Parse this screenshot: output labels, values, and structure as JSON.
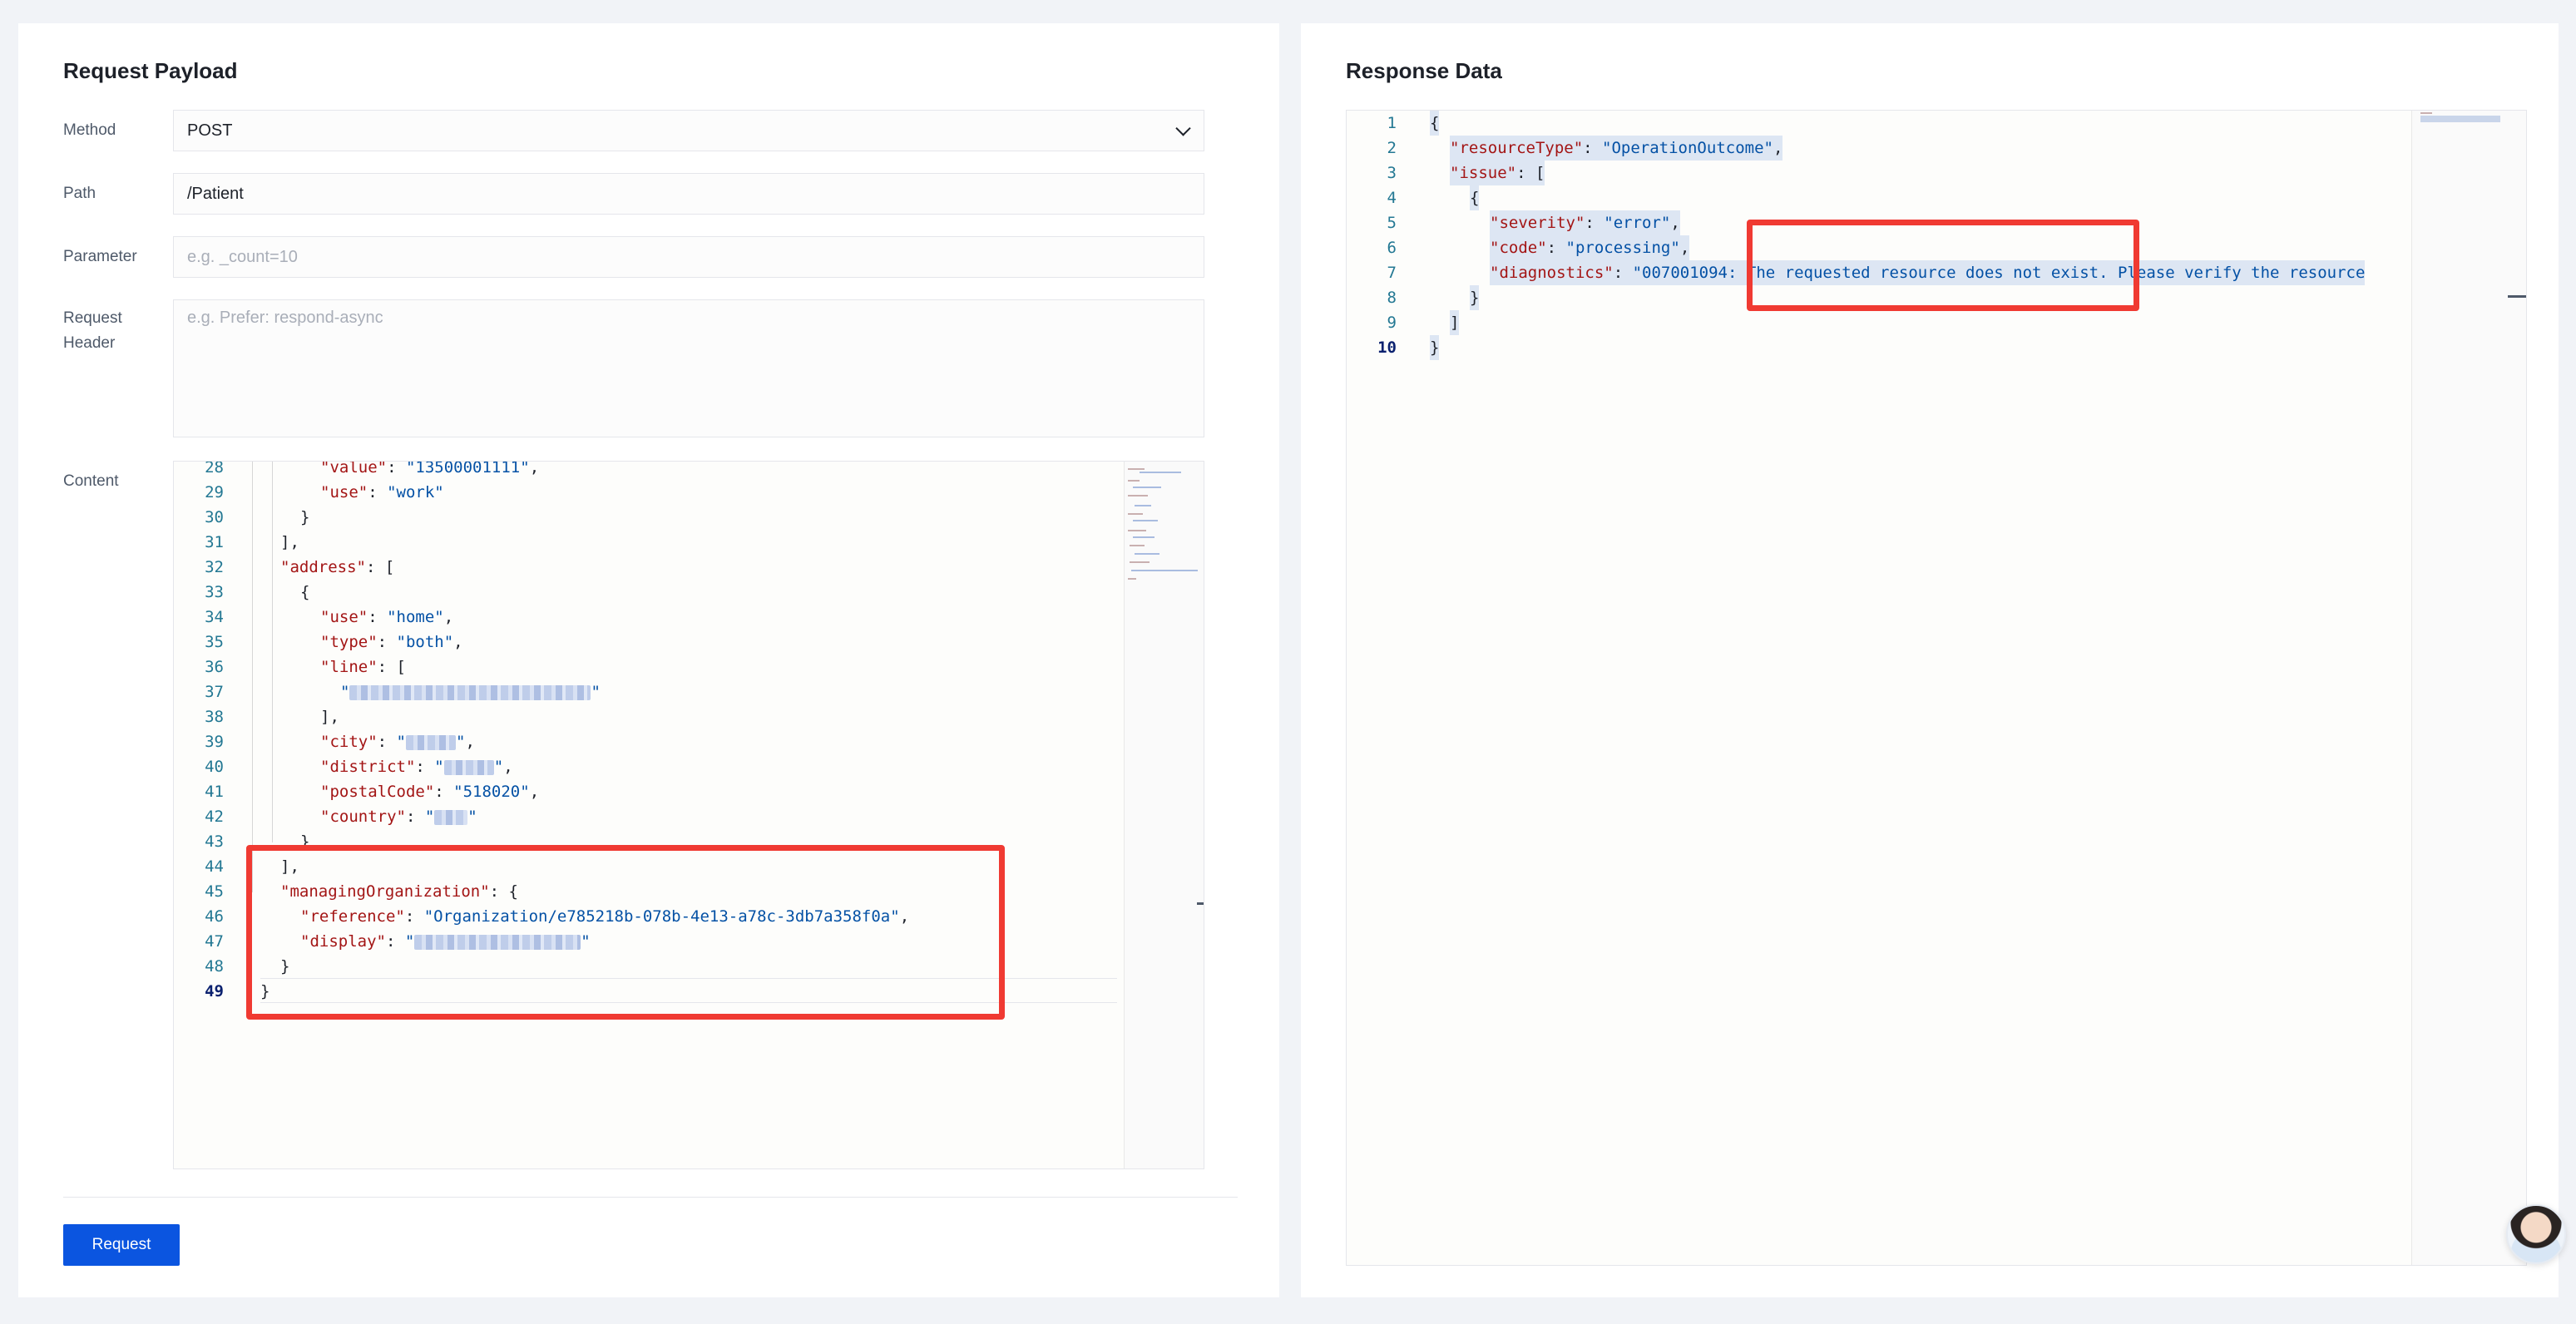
{
  "request": {
    "title": "Request Payload",
    "method_label": "Method",
    "method_value": "POST",
    "path_label": "Path",
    "path_value": "/Patient",
    "parameter_label": "Parameter",
    "parameter_placeholder": "e.g. _count=10",
    "header_label_line1": "Request",
    "header_label_line2": "Header",
    "header_placeholder": "e.g. Prefer: respond-async",
    "content_label": "Content",
    "button_label": "Request",
    "code_lines": [
      {
        "n": "28",
        "indent": 3,
        "key": "\"value\"",
        "val": "\"13500001111\"",
        "tail": ","
      },
      {
        "n": "29",
        "indent": 3,
        "key": "\"use\"",
        "val": "\"work\"",
        "tail": ""
      },
      {
        "n": "30",
        "indent": 2,
        "punct": "}"
      },
      {
        "n": "31",
        "indent": 1,
        "punct": "],"
      },
      {
        "n": "32",
        "indent": 1,
        "key": "\"address\"",
        "punct_after": ": ["
      },
      {
        "n": "33",
        "indent": 2,
        "punct": "{"
      },
      {
        "n": "34",
        "indent": 3,
        "key": "\"use\"",
        "val": "\"home\"",
        "tail": ","
      },
      {
        "n": "35",
        "indent": 3,
        "key": "\"type\"",
        "val": "\"both\"",
        "tail": ","
      },
      {
        "n": "36",
        "indent": 3,
        "key": "\"line\"",
        "punct_after": ": ["
      },
      {
        "n": "37",
        "indent": 4,
        "blur_val": true,
        "blur_w": 290,
        "tail": ""
      },
      {
        "n": "38",
        "indent": 3,
        "punct": "],"
      },
      {
        "n": "39",
        "indent": 3,
        "key": "\"city\"",
        "blur_val": true,
        "blur_w": 60,
        "tail": ","
      },
      {
        "n": "40",
        "indent": 3,
        "key": "\"district\"",
        "blur_val": true,
        "blur_w": 60,
        "tail": ","
      },
      {
        "n": "41",
        "indent": 3,
        "key": "\"postalCode\"",
        "val": "\"518020\"",
        "tail": ","
      },
      {
        "n": "42",
        "indent": 3,
        "key": "\"country\"",
        "blur_val": true,
        "blur_w": 40,
        "tail": ""
      },
      {
        "n": "43",
        "indent": 2,
        "punct": "}"
      },
      {
        "n": "44",
        "indent": 1,
        "punct": "],"
      },
      {
        "n": "45",
        "indent": 1,
        "key": "\"managingOrganization\"",
        "punct_after": ": {"
      },
      {
        "n": "46",
        "indent": 2,
        "key": "\"reference\"",
        "val": "\"Organization/e785218b-078b-4e13-a78c-3db7a358f0a\"",
        "tail": ","
      },
      {
        "n": "47",
        "indent": 2,
        "key": "\"display\"",
        "blur_val": true,
        "blur_w": 200,
        "tail": ""
      },
      {
        "n": "48",
        "indent": 1,
        "punct": "}"
      },
      {
        "n": "49",
        "indent": 0,
        "punct": "}",
        "active": true
      }
    ]
  },
  "response": {
    "title": "Response Data",
    "code_lines": [
      {
        "n": "1",
        "indent": 0,
        "punct": "{"
      },
      {
        "n": "2",
        "indent": 1,
        "key": "\"resourceType\"",
        "val": "\"OperationOutcome\"",
        "tail": ","
      },
      {
        "n": "3",
        "indent": 1,
        "key": "\"issue\"",
        "punct_after": ": ["
      },
      {
        "n": "4",
        "indent": 2,
        "punct": "{"
      },
      {
        "n": "5",
        "indent": 3,
        "key": "\"severity\"",
        "val": "\"error\"",
        "tail": ","
      },
      {
        "n": "6",
        "indent": 3,
        "key": "\"code\"",
        "val": "\"processing\"",
        "tail": ","
      },
      {
        "n": "7",
        "indent": 3,
        "key": "\"diagnostics\"",
        "val": "\"007001094: The requested resource does not exist. Please verify the resource",
        "tail": ""
      },
      {
        "n": "8",
        "indent": 2,
        "punct": "}"
      },
      {
        "n": "9",
        "indent": 1,
        "punct": "]"
      },
      {
        "n": "10",
        "indent": 0,
        "punct": "}",
        "active": true
      }
    ]
  },
  "colors": {
    "accent": "#0b55e0",
    "highlight": "#f03a32",
    "json_key": "#a31515",
    "json_string": "#0451a5"
  },
  "icons": {
    "method_dropdown": "chevron-down-icon",
    "assistant": "assistant-avatar"
  }
}
